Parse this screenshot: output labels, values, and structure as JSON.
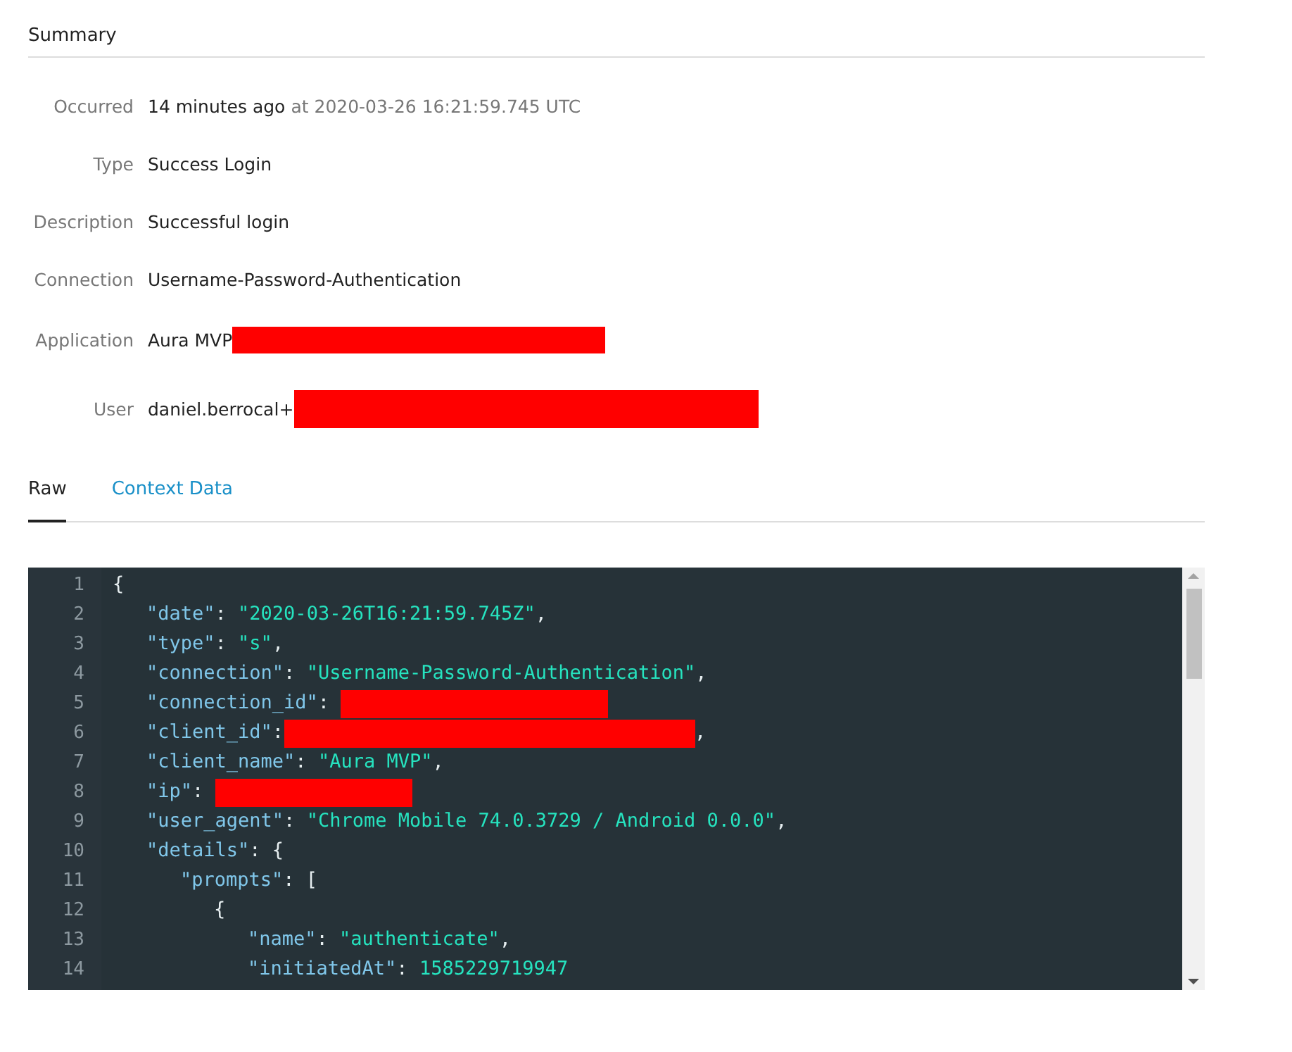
{
  "summary": {
    "title": "Summary",
    "fields": [
      {
        "label": "Occurred",
        "value": "14 minutes ago",
        "detail": "at 2020-03-26 16:21:59.745 UTC",
        "redacted": false
      },
      {
        "label": "Type",
        "value": "Success Login",
        "redacted": false
      },
      {
        "label": "Description",
        "value": "Successful login",
        "redacted": false
      },
      {
        "label": "Connection",
        "value": "Username-Password-Authentication",
        "redacted": false
      },
      {
        "label": "Application",
        "value": "Aura MVP",
        "redacted": true
      },
      {
        "label": "User",
        "value": "daniel.berrocal+",
        "redacted": true
      }
    ]
  },
  "tabs": [
    {
      "label": "Raw",
      "selected": true
    },
    {
      "label": "Context Data",
      "selected": false
    }
  ],
  "editor": {
    "lines": [
      {
        "number": "1",
        "segments": [
          {
            "kind": "punct",
            "text": "{"
          }
        ]
      },
      {
        "number": "2",
        "segments": [
          {
            "kind": "key",
            "text": "\"date\""
          },
          {
            "kind": "punct",
            "text": ": "
          },
          {
            "kind": "string",
            "text": "\"2020-03-26T16:21:59.745Z\""
          },
          {
            "kind": "punct",
            "text": ","
          }
        ]
      },
      {
        "number": "3",
        "segments": [
          {
            "kind": "key",
            "text": "\"type\""
          },
          {
            "kind": "punct",
            "text": ": "
          },
          {
            "kind": "string",
            "text": "\"s\""
          },
          {
            "kind": "punct",
            "text": ","
          }
        ]
      },
      {
        "number": "4",
        "segments": [
          {
            "kind": "key",
            "text": "\"connection\""
          },
          {
            "kind": "punct",
            "text": ": "
          },
          {
            "kind": "string",
            "text": "\"Username-Password-Authentication\""
          },
          {
            "kind": "punct",
            "text": ","
          }
        ]
      },
      {
        "number": "5",
        "segments": [
          {
            "kind": "key",
            "text": "\"connection_id\""
          },
          {
            "kind": "punct",
            "text": ": "
          },
          {
            "kind": "redaction"
          }
        ]
      },
      {
        "number": "6",
        "segments": [
          {
            "kind": "key",
            "text": "\"client_id\""
          },
          {
            "kind": "punct",
            "text": ":"
          },
          {
            "kind": "redaction"
          },
          {
            "kind": "punct",
            "text": ","
          }
        ]
      },
      {
        "number": "7",
        "segments": [
          {
            "kind": "key",
            "text": "\"client_name\""
          },
          {
            "kind": "punct",
            "text": ": "
          },
          {
            "kind": "string",
            "text": "\"Aura MVP\""
          },
          {
            "kind": "punct",
            "text": ","
          }
        ]
      },
      {
        "number": "8",
        "segments": [
          {
            "kind": "key",
            "text": "\"ip\""
          },
          {
            "kind": "punct",
            "text": ": "
          },
          {
            "kind": "redaction"
          }
        ]
      },
      {
        "number": "9",
        "segments": [
          {
            "kind": "key",
            "text": "\"user_agent\""
          },
          {
            "kind": "punct",
            "text": ": "
          },
          {
            "kind": "string",
            "text": "\"Chrome Mobile 74.0.3729 / Android 0.0.0\""
          },
          {
            "kind": "punct",
            "text": ","
          }
        ]
      },
      {
        "number": "10",
        "segments": [
          {
            "kind": "key",
            "text": "\"details\""
          },
          {
            "kind": "punct",
            "text": ": {"
          }
        ]
      },
      {
        "number": "11",
        "segments": [
          {
            "kind": "key",
            "text": "\"prompts\""
          },
          {
            "kind": "punct",
            "text": ": ["
          }
        ]
      },
      {
        "number": "12",
        "segments": [
          {
            "kind": "punct",
            "text": "{"
          }
        ]
      },
      {
        "number": "13",
        "segments": [
          {
            "kind": "key",
            "text": "\"name\""
          },
          {
            "kind": "punct",
            "text": ": "
          },
          {
            "kind": "string",
            "text": "\"authenticate\""
          },
          {
            "kind": "punct",
            "text": ","
          }
        ]
      },
      {
        "number": "14",
        "segments": [
          {
            "kind": "key",
            "text": "\"initiatedAt\""
          },
          {
            "kind": "punct",
            "text": ": "
          },
          {
            "kind": "number",
            "text": "1585229719947"
          }
        ]
      }
    ]
  }
}
